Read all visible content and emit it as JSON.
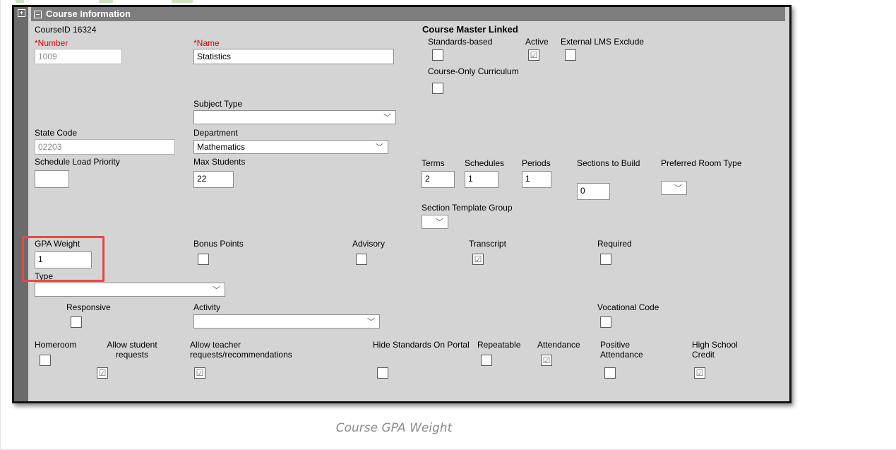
{
  "section": {
    "title": "Course Information"
  },
  "course_id": "CourseID 16324",
  "course_master_linked": "Course Master Linked",
  "fields": {
    "number": {
      "label": "*Number",
      "value": "1009"
    },
    "name": {
      "label": "*Name",
      "value": "Statistics"
    },
    "standards_based": {
      "label": "Standards-based",
      "checked": false
    },
    "active": {
      "label": "Active",
      "checked": true
    },
    "external_lms_exclude": {
      "label": "External LMS Exclude",
      "checked": false
    },
    "course_only_curriculum": {
      "label": "Course-Only Curriculum",
      "checked": false
    },
    "subject_type": {
      "label": "Subject Type",
      "value": ""
    },
    "state_code": {
      "label": "State Code",
      "value": "02203"
    },
    "department": {
      "label": "Department",
      "value": "Mathematics"
    },
    "schedule_load_priority": {
      "label": "Schedule Load Priority",
      "value": ""
    },
    "max_students": {
      "label": "Max Students",
      "value": "22"
    },
    "terms": {
      "label": "Terms",
      "value": "2"
    },
    "schedules": {
      "label": "Schedules",
      "value": "1"
    },
    "periods": {
      "label": "Periods",
      "value": "1"
    },
    "sections_to_build": {
      "label": "Sections to Build",
      "value": "0"
    },
    "preferred_room_type": {
      "label": "Preferred Room Type",
      "value": ""
    },
    "section_template_group": {
      "label": "Section Template Group",
      "value": ""
    },
    "gpa_weight": {
      "label": "GPA Weight",
      "value": "1"
    },
    "bonus_points": {
      "label": "Bonus Points",
      "checked": false
    },
    "advisory": {
      "label": "Advisory",
      "checked": false
    },
    "transcript": {
      "label": "Transcript",
      "checked": true
    },
    "required": {
      "label": "Required",
      "checked": false
    },
    "type": {
      "label": "Type",
      "value": ""
    },
    "responsive": {
      "label": "Responsive",
      "checked": false
    },
    "activity": {
      "label": "Activity",
      "value": ""
    },
    "vocational_code": {
      "label": "Vocational Code",
      "checked": false
    },
    "homeroom": {
      "label": "Homeroom",
      "checked": false
    },
    "allow_student_requests": {
      "label": "Allow student requests",
      "checked": true
    },
    "allow_teacher_requests": {
      "label": "Allow teacher requests/recommendations",
      "checked": true
    },
    "hide_standards_on_portal": {
      "label": "Hide Standards On Portal",
      "checked": false
    },
    "repeatable": {
      "label": "Repeatable",
      "checked": false
    },
    "attendance": {
      "label": "Attendance",
      "checked": true
    },
    "positive_attendance": {
      "label": "Positive Attendance",
      "checked": false
    },
    "high_school_credit": {
      "label": "High School Credit",
      "checked": true
    }
  },
  "caption": "Course GPA Weight",
  "colors": {
    "highlight": "#e24a4a",
    "header": "#7d7d7d",
    "form_bg": "#d4d4d4",
    "required_label": "#e30000"
  }
}
